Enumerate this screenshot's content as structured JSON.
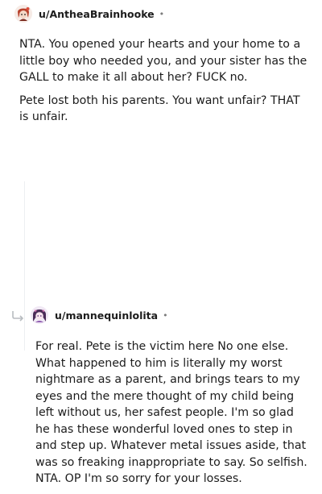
{
  "comments": [
    {
      "username": "u/AntheaBrainhooke",
      "separator": "•",
      "avatar_icon": "red-hair-avatar-icon",
      "paragraphs": [
        "NTA. You opened your hearts and your home to a little boy who needed you, and your sister has the GALL to make it all about her? FUCK no.",
        "Pete lost both his parents. You want unfair? THAT is unfair."
      ]
    },
    {
      "username": "u/mannequinlolita",
      "separator": "•",
      "avatar_icon": "purple-lolita-avatar-icon",
      "reply_icon": "reply-arrow-icon",
      "paragraphs": [
        "For real. Pete is the victim here No one else. What happened to him is literally my worst nightmare as a parent, and brings tears to my eyes and the mere thought of my child being left without us, her safest people. I'm so glad he has these wonderful loved ones to step in and step up. Whatever metal issues aside, that was so freaking inappropriate to say. So selfish. NTA. OP I'm so sorry for your losses."
      ]
    }
  ]
}
